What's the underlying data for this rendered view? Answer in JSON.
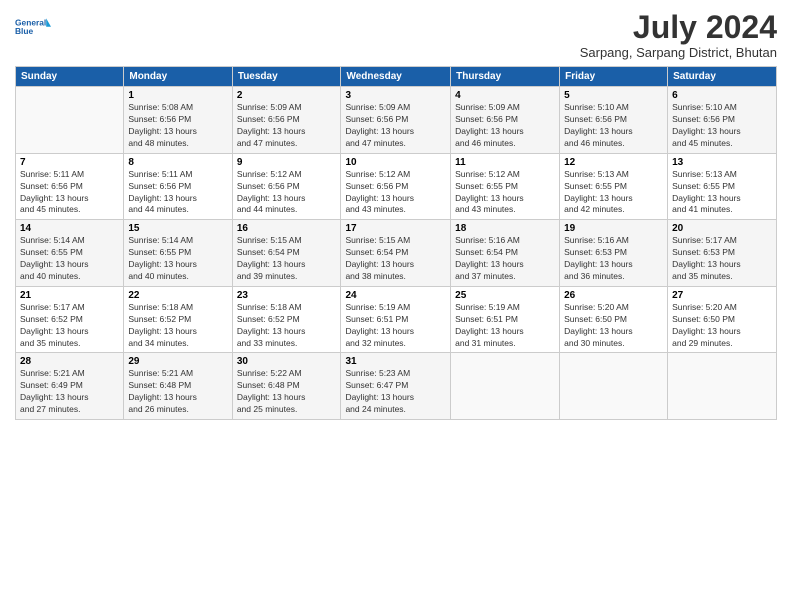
{
  "header": {
    "logo_line1": "General",
    "logo_line2": "Blue",
    "month_year": "July 2024",
    "location": "Sarpang, Sarpang District, Bhutan"
  },
  "weekdays": [
    "Sunday",
    "Monday",
    "Tuesday",
    "Wednesday",
    "Thursday",
    "Friday",
    "Saturday"
  ],
  "weeks": [
    [
      {
        "num": "",
        "info": ""
      },
      {
        "num": "1",
        "info": "Sunrise: 5:08 AM\nSunset: 6:56 PM\nDaylight: 13 hours\nand 48 minutes."
      },
      {
        "num": "2",
        "info": "Sunrise: 5:09 AM\nSunset: 6:56 PM\nDaylight: 13 hours\nand 47 minutes."
      },
      {
        "num": "3",
        "info": "Sunrise: 5:09 AM\nSunset: 6:56 PM\nDaylight: 13 hours\nand 47 minutes."
      },
      {
        "num": "4",
        "info": "Sunrise: 5:09 AM\nSunset: 6:56 PM\nDaylight: 13 hours\nand 46 minutes."
      },
      {
        "num": "5",
        "info": "Sunrise: 5:10 AM\nSunset: 6:56 PM\nDaylight: 13 hours\nand 46 minutes."
      },
      {
        "num": "6",
        "info": "Sunrise: 5:10 AM\nSunset: 6:56 PM\nDaylight: 13 hours\nand 45 minutes."
      }
    ],
    [
      {
        "num": "7",
        "info": "Sunrise: 5:11 AM\nSunset: 6:56 PM\nDaylight: 13 hours\nand 45 minutes."
      },
      {
        "num": "8",
        "info": "Sunrise: 5:11 AM\nSunset: 6:56 PM\nDaylight: 13 hours\nand 44 minutes."
      },
      {
        "num": "9",
        "info": "Sunrise: 5:12 AM\nSunset: 6:56 PM\nDaylight: 13 hours\nand 44 minutes."
      },
      {
        "num": "10",
        "info": "Sunrise: 5:12 AM\nSunset: 6:56 PM\nDaylight: 13 hours\nand 43 minutes."
      },
      {
        "num": "11",
        "info": "Sunrise: 5:12 AM\nSunset: 6:55 PM\nDaylight: 13 hours\nand 43 minutes."
      },
      {
        "num": "12",
        "info": "Sunrise: 5:13 AM\nSunset: 6:55 PM\nDaylight: 13 hours\nand 42 minutes."
      },
      {
        "num": "13",
        "info": "Sunrise: 5:13 AM\nSunset: 6:55 PM\nDaylight: 13 hours\nand 41 minutes."
      }
    ],
    [
      {
        "num": "14",
        "info": "Sunrise: 5:14 AM\nSunset: 6:55 PM\nDaylight: 13 hours\nand 40 minutes."
      },
      {
        "num": "15",
        "info": "Sunrise: 5:14 AM\nSunset: 6:55 PM\nDaylight: 13 hours\nand 40 minutes."
      },
      {
        "num": "16",
        "info": "Sunrise: 5:15 AM\nSunset: 6:54 PM\nDaylight: 13 hours\nand 39 minutes."
      },
      {
        "num": "17",
        "info": "Sunrise: 5:15 AM\nSunset: 6:54 PM\nDaylight: 13 hours\nand 38 minutes."
      },
      {
        "num": "18",
        "info": "Sunrise: 5:16 AM\nSunset: 6:54 PM\nDaylight: 13 hours\nand 37 minutes."
      },
      {
        "num": "19",
        "info": "Sunrise: 5:16 AM\nSunset: 6:53 PM\nDaylight: 13 hours\nand 36 minutes."
      },
      {
        "num": "20",
        "info": "Sunrise: 5:17 AM\nSunset: 6:53 PM\nDaylight: 13 hours\nand 35 minutes."
      }
    ],
    [
      {
        "num": "21",
        "info": "Sunrise: 5:17 AM\nSunset: 6:52 PM\nDaylight: 13 hours\nand 35 minutes."
      },
      {
        "num": "22",
        "info": "Sunrise: 5:18 AM\nSunset: 6:52 PM\nDaylight: 13 hours\nand 34 minutes."
      },
      {
        "num": "23",
        "info": "Sunrise: 5:18 AM\nSunset: 6:52 PM\nDaylight: 13 hours\nand 33 minutes."
      },
      {
        "num": "24",
        "info": "Sunrise: 5:19 AM\nSunset: 6:51 PM\nDaylight: 13 hours\nand 32 minutes."
      },
      {
        "num": "25",
        "info": "Sunrise: 5:19 AM\nSunset: 6:51 PM\nDaylight: 13 hours\nand 31 minutes."
      },
      {
        "num": "26",
        "info": "Sunrise: 5:20 AM\nSunset: 6:50 PM\nDaylight: 13 hours\nand 30 minutes."
      },
      {
        "num": "27",
        "info": "Sunrise: 5:20 AM\nSunset: 6:50 PM\nDaylight: 13 hours\nand 29 minutes."
      }
    ],
    [
      {
        "num": "28",
        "info": "Sunrise: 5:21 AM\nSunset: 6:49 PM\nDaylight: 13 hours\nand 27 minutes."
      },
      {
        "num": "29",
        "info": "Sunrise: 5:21 AM\nSunset: 6:48 PM\nDaylight: 13 hours\nand 26 minutes."
      },
      {
        "num": "30",
        "info": "Sunrise: 5:22 AM\nSunset: 6:48 PM\nDaylight: 13 hours\nand 25 minutes."
      },
      {
        "num": "31",
        "info": "Sunrise: 5:23 AM\nSunset: 6:47 PM\nDaylight: 13 hours\nand 24 minutes."
      },
      {
        "num": "",
        "info": ""
      },
      {
        "num": "",
        "info": ""
      },
      {
        "num": "",
        "info": ""
      }
    ]
  ]
}
